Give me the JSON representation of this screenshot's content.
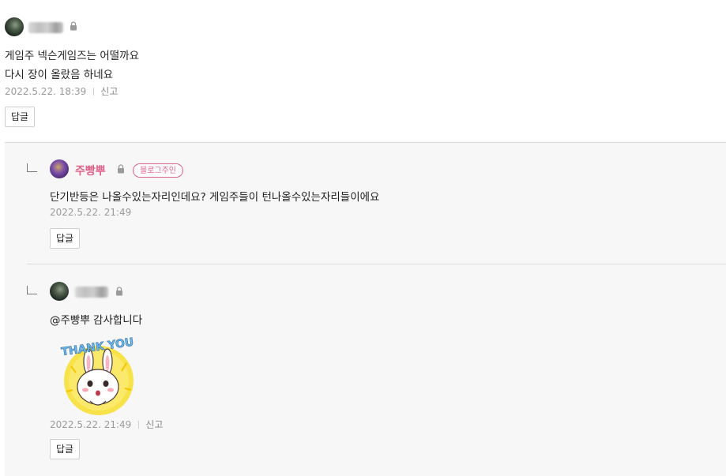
{
  "comment": {
    "line1": "게임주 넥슨게임즈는 어떨까요",
    "line2": "다시 장이 올랐음 하네요",
    "date": "2022.5.22. 18:39",
    "report": "신고",
    "reply_button": "답글"
  },
  "reply1": {
    "author": "주빵뿌",
    "badge": "블로그주인",
    "text": "단기반등은 나올수있는자리인데요? 게임주들이 턴나올수있는자리들이에요",
    "date": "2022.5.22. 21:49",
    "reply_button": "답글"
  },
  "reply2": {
    "text": "@주빵뿌 감사합니다",
    "sticker_text": "THANK YOU",
    "date": "2022.5.22. 21:49",
    "report": "신고",
    "reply_button": "답글"
  },
  "colors": {
    "accent": "#e0628a",
    "reply_bg": "#f7f7f7"
  },
  "icons": [
    "avatar",
    "lock-icon",
    "reply-arrow-icon",
    "thank-you-sticker"
  ]
}
